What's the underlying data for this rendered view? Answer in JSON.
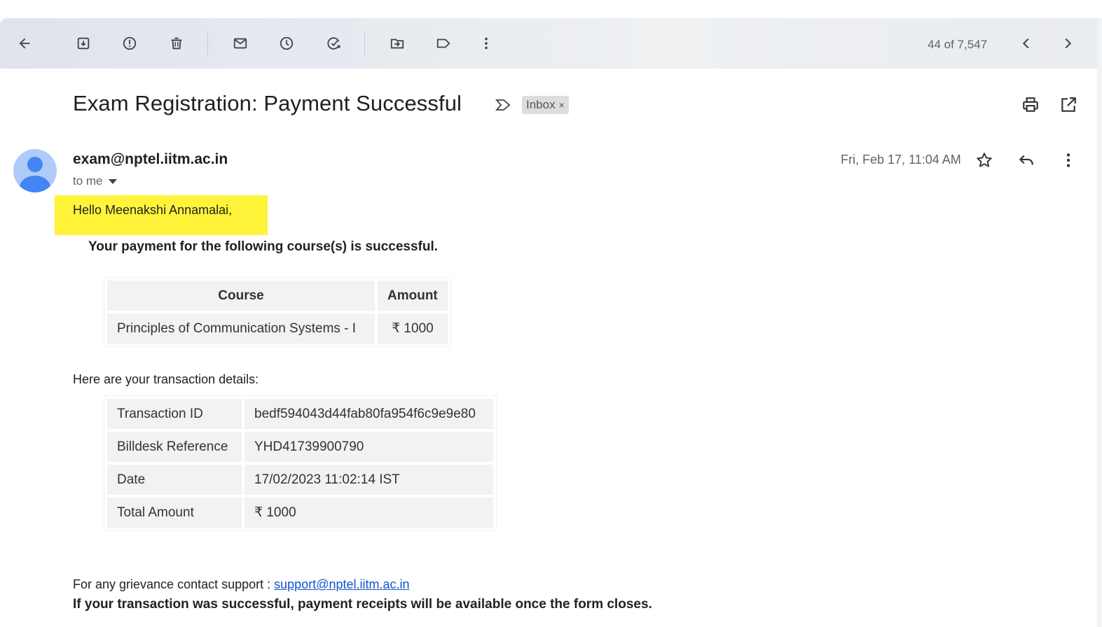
{
  "toolbar": {
    "icons": [
      "back-arrow-icon",
      "archive-icon",
      "report-spam-icon",
      "delete-icon",
      "mark-unread-icon",
      "snooze-icon",
      "add-to-tasks-icon",
      "move-to-icon",
      "label-icon",
      "more-vert-icon"
    ],
    "count": "44 of 7,547"
  },
  "email": {
    "subject": "Exam Registration: Payment Successful",
    "label_chip": "Inbox",
    "chip_close": "×",
    "sender": "exam@nptel.iitm.ac.in",
    "to": "to me",
    "date": "Fri, Feb 17, 11:04 AM",
    "greeting": "Hello Meenakshi Annamalai,",
    "lead": "Your payment for the following course(s) is successful.",
    "course_table": {
      "headers": [
        "Course",
        "Amount"
      ],
      "rows": [
        [
          "Principles of Communication Systems - I",
          "₹ 1000"
        ]
      ]
    },
    "transaction_intro": "Here are your transaction details:",
    "transaction_table": [
      [
        "Transaction ID",
        "bedf594043d44fab80fa954f6c9e9e80"
      ],
      [
        "Billdesk Reference",
        "YHD41739900790"
      ],
      [
        "Date",
        "17/02/2023 11:02:14 IST"
      ],
      [
        "Total Amount",
        "₹ 1000"
      ]
    ],
    "support_prefix": "For any grievance contact support : ",
    "support_link": "support@nptel.iitm.ac.in",
    "receipts_note": "If your transaction was successful, payment receipts will be available once the form closes."
  },
  "colors": {
    "highlight": "#fff43a",
    "link": "#1155cc",
    "avatar_bg": "#aecbfa",
    "avatar_fg": "#4285f4"
  }
}
